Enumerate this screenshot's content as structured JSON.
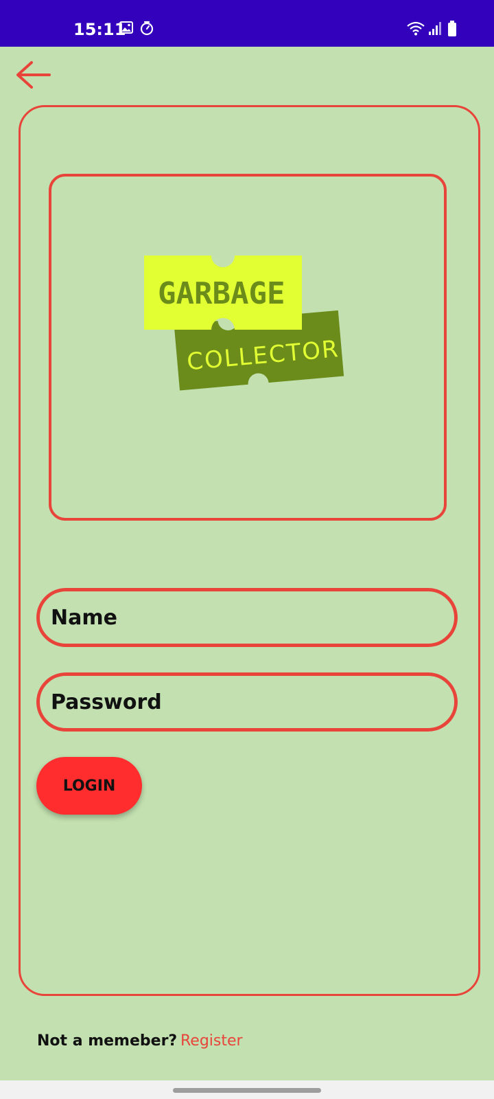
{
  "status_bar": {
    "time": "15:11",
    "left_icons": [
      "image-icon",
      "timer-icon"
    ],
    "right_icons": [
      "wifi-icon",
      "signal-icon",
      "battery-icon"
    ]
  },
  "toolbar": {
    "back_icon": "arrow-left-icon",
    "accent_color": "#e8443a"
  },
  "logo": {
    "top_word": "GARBAGE",
    "bottom_word": "COLLECTOR",
    "top_color": "#e2ff33",
    "bottom_color": "#6b8c1a"
  },
  "form": {
    "name_placeholder": "Name",
    "password_placeholder": "Password",
    "login_label": "LOGIN"
  },
  "footer": {
    "prompt": "Not a memeber?",
    "register_label": "Register"
  },
  "colors": {
    "background": "#c2e0b0",
    "status_bar": "#3300bb",
    "button": "#ff2d2d",
    "border": "#e8443a"
  }
}
